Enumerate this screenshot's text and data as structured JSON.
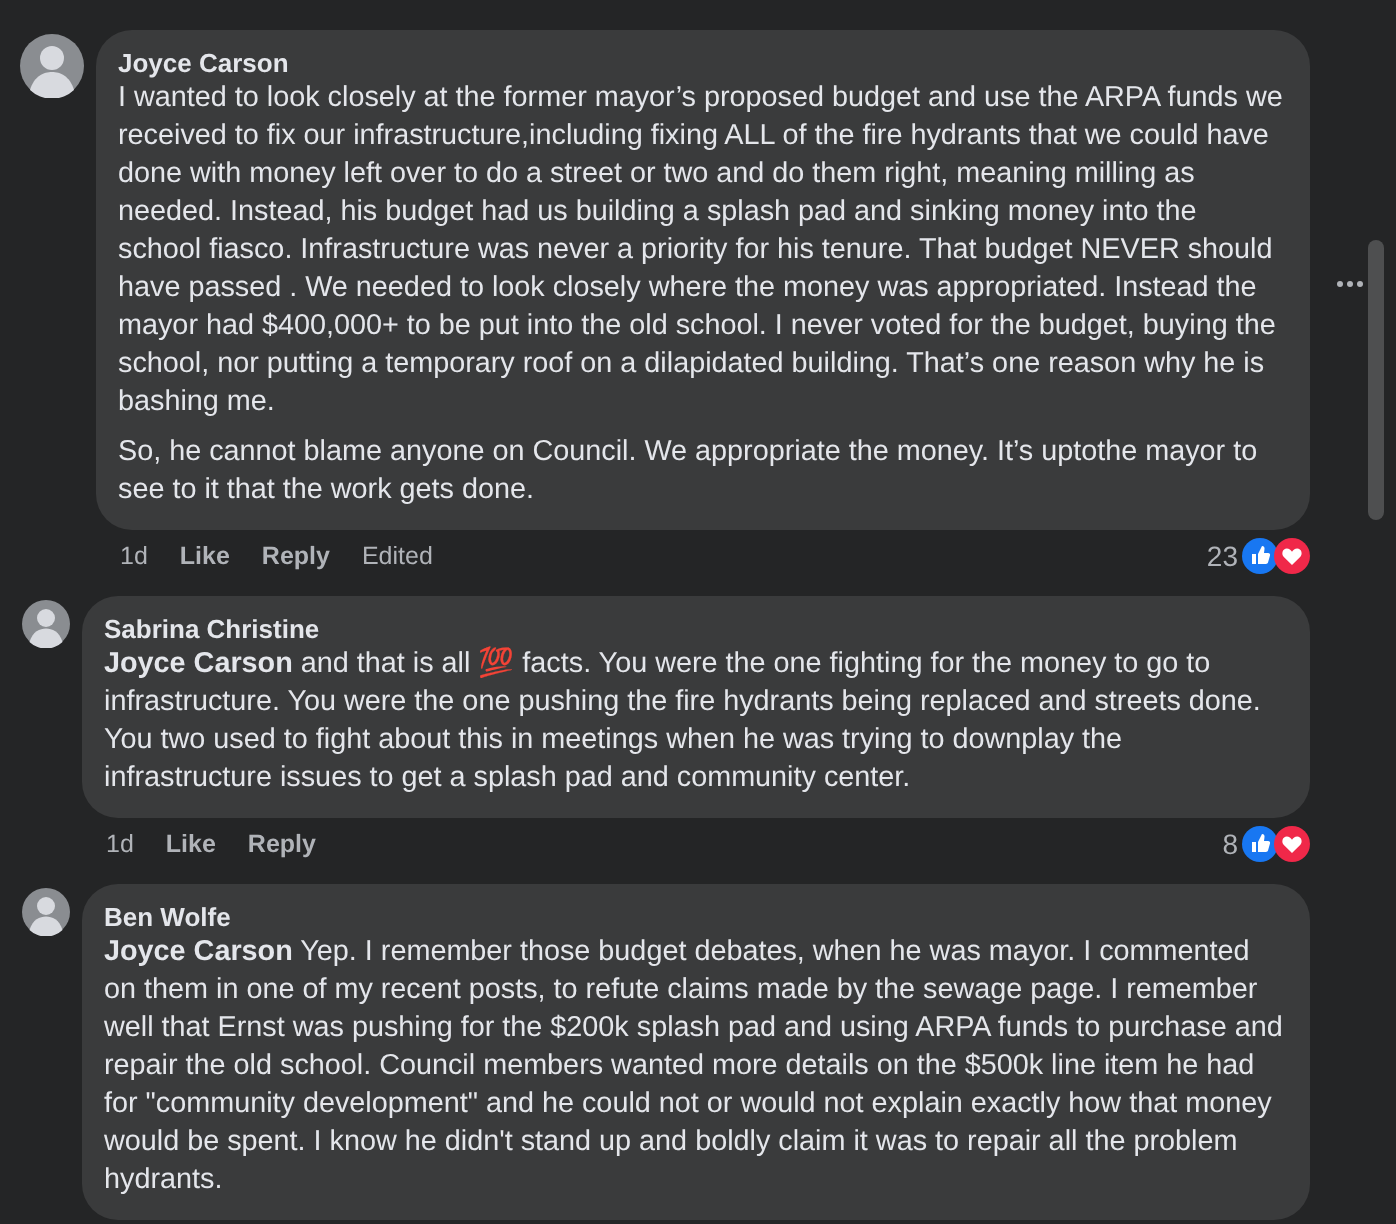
{
  "comments": [
    {
      "author": "Joyce Carson",
      "paragraphs": [
        "I wanted to look closely at the former mayor’s proposed budget and use the ARPA funds we received to fix our infrastructure,including fixing ALL of the fire hydrants that we could have done with money left over to do a street or two and do them right, meaning milling as needed. Instead, his budget had us building a splash pad and sinking money into the school fiasco. Infrastructure was never a priority for his tenure. That budget NEVER should have passed . We needed to look closely where the money was appropriated. Instead the mayor had $400,000+ to be put into the old school. I never voted for the budget, buying the school, nor putting a temporary roof on a dilapidated building. That’s one reason why he is bashing me.",
        "So, he cannot blame anyone on Council. We appropriate the money. It’s uptothe mayor to see to it that the work gets done."
      ],
      "time": "1d",
      "actions": [
        "Like",
        "Reply"
      ],
      "edited": "Edited",
      "reaction_count": "23",
      "children": [
        {
          "author": "Sabrina Christine",
          "paragraphs": [
            "**Joyce Carson** and that is all 💯 facts. You were the one fighting for the money to go to infrastructure. You were the one pushing the fire hydrants being replaced and streets done. You two used to fight about this in meetings when he was trying to downplay the infrastructure issues to get a splash pad and community center."
          ],
          "time": "1d",
          "actions": [
            "Like",
            "Reply"
          ],
          "reaction_count": "8"
        },
        {
          "author": "Ben Wolfe",
          "paragraphs": [
            "**Joyce Carson** Yep. I remember those budget debates, when he was mayor. I commented on them in one of my recent posts, to refute claims made by the sewage page. I remember well that Ernst was pushing for the $200k splash pad and using ARPA funds to purchase and repair the old school. Council members wanted more details on the $500k line item he had for \"community development\" and he could not or would not explain exactly how that money would be spent. I know he didn't stand up and boldly claim it was to repair all the problem hydrants."
          ]
        }
      ]
    }
  ]
}
